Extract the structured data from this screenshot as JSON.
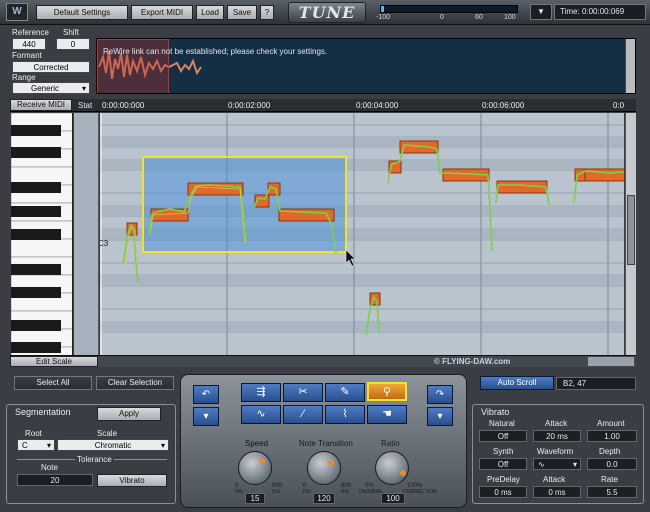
{
  "toolbar": {
    "logo": "W",
    "default_settings": "Default Settings",
    "export_midi": "Export MIDI",
    "load": "Load",
    "save": "Save",
    "help": "?",
    "app_title": "TUNE",
    "meter_ticks": [
      "-100",
      "0",
      "60",
      "100"
    ],
    "menu_arrow": "▼",
    "time_label": "Time:",
    "time_value": "0:00:00:069"
  },
  "params": {
    "reference_label": "Reference",
    "reference_value": "440",
    "shift_label": "Shift",
    "shift_value": "0",
    "formant_label": "Formant",
    "formant_value": "Corrected",
    "range_label": "Range",
    "range_value": "Generic"
  },
  "waveform": {
    "status_message": "ReWire link can not be established; please check your settings."
  },
  "graph": {
    "receive_midi": "Receive MIDI",
    "stat_label": "Stat",
    "timeline": [
      "0:00:00:000",
      "0:00:02:000",
      "0:00:04:000",
      "0:00:06:000"
    ],
    "timeline_cutoff": "0:0",
    "note_marker": "C3",
    "watermark": "© FLYING-DAW.com",
    "edit_scale": "Edit Scale"
  },
  "transport": {
    "select_all": "Select All",
    "clear_selection": "Clear Selection",
    "auto_scroll": "Auto Scroll",
    "note_readout": "B2, 47"
  },
  "segmentation": {
    "title": "Segmentation",
    "apply": "Apply",
    "root_label": "Root",
    "root_value": "C",
    "scale_label": "Scale",
    "scale_value": "Chromatic",
    "tolerance_label": "Tolerance",
    "note_label": "Note",
    "note_value": "20",
    "vibrato_button": "Vibrato"
  },
  "tools_panel": {
    "speed_label": "Speed",
    "speed_min": "0",
    "speed_max": "800",
    "speed_unit": "ms",
    "speed_value": "15",
    "note_transition_label": "Note Transition",
    "nt_min": "0",
    "nt_max": "800",
    "nt_unit": "ms",
    "nt_value": "120",
    "ratio_label": "Ratio",
    "ratio_min": "0%",
    "ratio_min_note": "ORIGINAL",
    "ratio_max": "100%",
    "ratio_max_note": "CORRECTION",
    "ratio_value": "100"
  },
  "vibrato": {
    "title": "Vibrato",
    "natural_label": "Natural",
    "natural_value": "Off",
    "attack_label": "Attack",
    "attack_value": "20 ms",
    "amount_label": "Amount",
    "amount_value": "1.00",
    "synth_label": "Synth",
    "synth_value": "Off",
    "waveform_label": "Waveform",
    "depth_label": "Depth",
    "depth_value": "0.0",
    "predelay_label": "PreDelay",
    "predelay_value": "0 ms",
    "attack2_label": "Attack",
    "attack2_value": "0 ms",
    "rate_label": "Rate",
    "rate_value": "5.5"
  },
  "colors": {
    "accent_blue": "#3f6fb8",
    "selection_yellow": "#f3e12a",
    "note_orange": "#e2692a",
    "pitch_green": "#7bd24a"
  }
}
